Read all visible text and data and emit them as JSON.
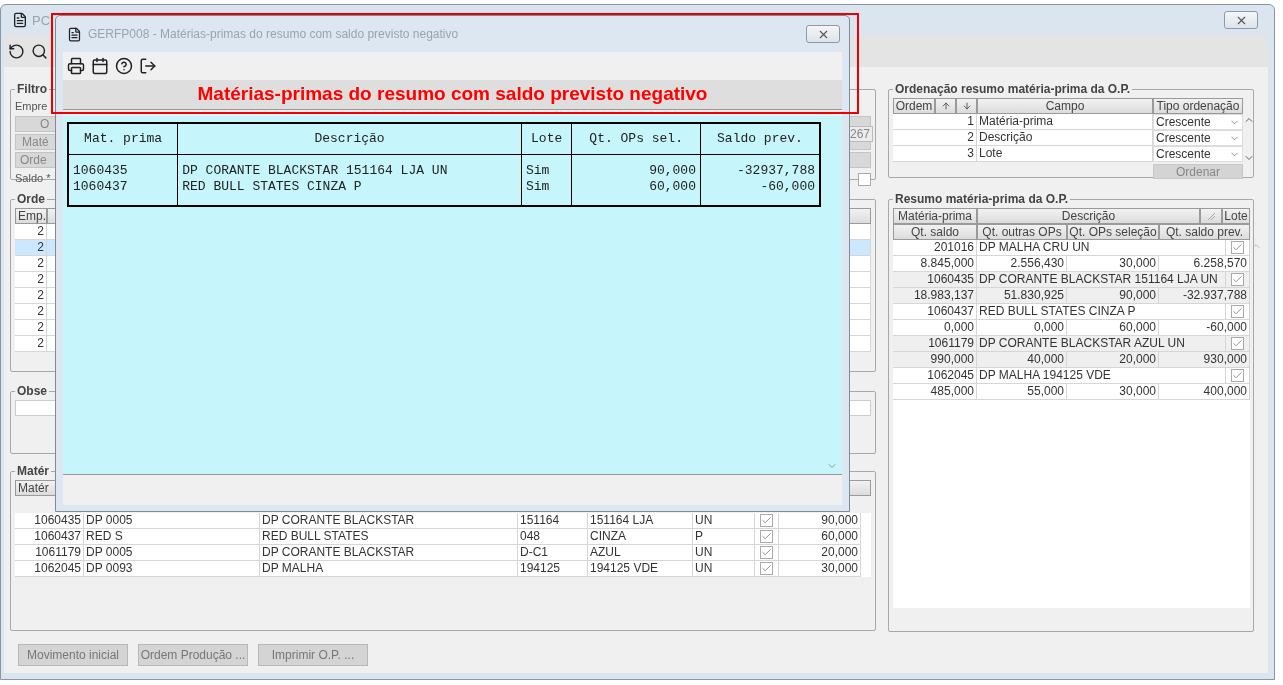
{
  "window": {
    "title": "PC"
  },
  "filter": {
    "title": "Filtro",
    "company_label": "Empre",
    "buttons": [
      "O",
      "Maté",
      "Orde"
    ],
    "balance_label": "Saldo *",
    "field_value": "267",
    "checked": false
  },
  "orders": {
    "title": "Orde",
    "columns": [
      "Emp."
    ],
    "rows": [
      {
        "company": "2",
        "selected": false
      },
      {
        "company": "2",
        "selected": true
      },
      {
        "company": "2",
        "selected": false
      },
      {
        "company": "2",
        "selected": false
      },
      {
        "company": "2",
        "selected": false
      },
      {
        "company": "2",
        "selected": false
      },
      {
        "company": "2",
        "selected": false
      },
      {
        "company": "2",
        "selected": false
      }
    ]
  },
  "notes": {
    "title": "Obse"
  },
  "materials": {
    "title": "Matér",
    "columns": [
      "Matér"
    ],
    "rows": [
      {
        "cells": [
          "1060435",
          "DP 0005",
          "DP CORANTE BLACKSTAR",
          "151164",
          "151164 LJA",
          "UN"
        ],
        "checked": true,
        "quantity": "90,000"
      },
      {
        "cells": [
          "1060437",
          "RED S",
          "RED BULL STATES",
          "048",
          "CINZA",
          "P"
        ],
        "checked": true,
        "quantity": "60,000"
      },
      {
        "cells": [
          "1061179",
          "DP 0005",
          "DP CORANTE BLACKSTAR",
          "D-C1",
          "AZUL",
          "UN"
        ],
        "checked": true,
        "quantity": "20,000"
      },
      {
        "cells": [
          "1062045",
          "DP 0093",
          "DP MALHA",
          "194125",
          "194125 VDE",
          "UN"
        ],
        "checked": true,
        "quantity": "30,000"
      }
    ]
  },
  "actions": [
    "Movimento inicial",
    "Ordem Produção ...",
    "Imprimir O.P. ..."
  ],
  "sort": {
    "title": "Ordenação resumo matéria-prima da O.P.",
    "columns": [
      "Ordem",
      "Campo",
      "Tipo ordenação"
    ],
    "rows": [
      {
        "order": "1",
        "field": "Matéria-prima",
        "type": "Crescente"
      },
      {
        "order": "2",
        "field": "Descrição",
        "type": "Crescente"
      },
      {
        "order": "3",
        "field": "Lote",
        "type": "Crescente"
      }
    ],
    "button": "Ordenar"
  },
  "summary": {
    "title": "Resumo matéria-prima da O.P.",
    "header_top": [
      "Matéria-prima",
      "Descrição",
      "Lote"
    ],
    "header_bottom": [
      "Qt. saldo",
      "Qt. outras OPs",
      "Qt. OPs seleção",
      "Qt. saldo prev."
    ],
    "rows": [
      {
        "code": "201016",
        "description": "DP MALHA CRU UN",
        "checked": true,
        "values": [
          "8.845,000",
          "2.556,430",
          "30,000",
          "6.258,570"
        ]
      },
      {
        "code": "1060435",
        "description": "DP CORANTE BLACKSTAR 151164 LJA UN",
        "checked": true,
        "values": [
          "18.983,137",
          "51.830,925",
          "90,000",
          "-32.937,788"
        ]
      },
      {
        "code": "1060437",
        "description": "RED BULL STATES CINZA P",
        "checked": true,
        "values": [
          "0,000",
          "0,000",
          "60,000",
          "-60,000"
        ]
      },
      {
        "code": "1061179",
        "description": "DP CORANTE BLACKSTAR AZUL UN",
        "checked": true,
        "values": [
          "990,000",
          "40,000",
          "20,000",
          "930,000"
        ]
      },
      {
        "code": "1062045",
        "description": "DP MALHA 194125 VDE",
        "checked": true,
        "values": [
          "485,000",
          "55,000",
          "30,000",
          "400,000"
        ]
      }
    ]
  },
  "dialog": {
    "title": "GERFP008 - Matérias-primas do resumo com saldo previsto negativo",
    "heading": "Matérias-primas do resumo com saldo previsto negativo",
    "report": {
      "columns": [
        "Mat. prima",
        "Descrição",
        "Lote",
        "Qt. OPs sel.",
        "Saldo prev."
      ],
      "rows": [
        [
          "1060435",
          "DP CORANTE BLACKSTAR 151164 LJA UN",
          "Sim",
          "90,000",
          "-32937,788"
        ],
        [
          "1060437",
          "RED BULL STATES CINZA P",
          "Sim",
          "60,000",
          "-60,000"
        ]
      ]
    }
  }
}
